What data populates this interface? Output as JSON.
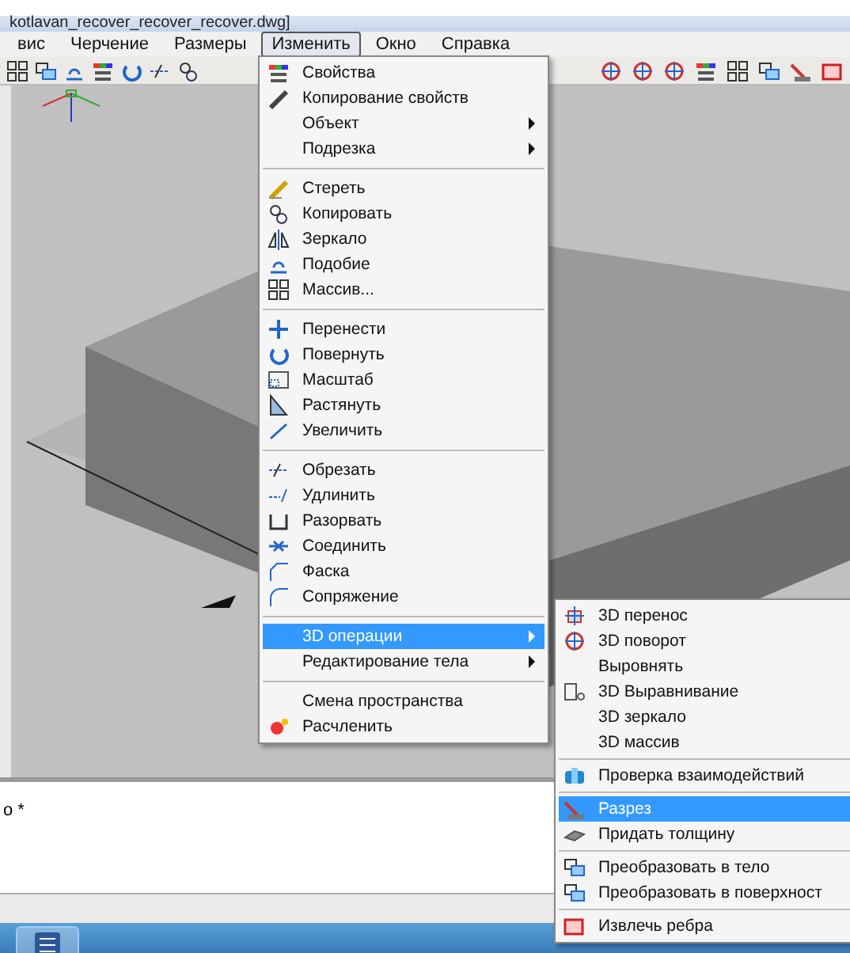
{
  "window": {
    "title": "kotlavan_recover_recover_recover.dwg]"
  },
  "menubar": [
    {
      "label": "вис",
      "selected": false
    },
    {
      "label": "Черчение",
      "selected": false
    },
    {
      "label": "Размеры",
      "selected": false
    },
    {
      "label": "Изменить",
      "selected": true
    },
    {
      "label": "Окно",
      "selected": false
    },
    {
      "label": "Справка",
      "selected": false
    }
  ],
  "menu": [
    {
      "kind": "item",
      "label": "Свойства",
      "has_submenu": false,
      "selected": false
    },
    {
      "kind": "item",
      "label": "Копирование свойств",
      "has_submenu": false,
      "selected": false
    },
    {
      "kind": "item",
      "label": "Объект",
      "has_submenu": true,
      "selected": false
    },
    {
      "kind": "item",
      "label": "Подрезка",
      "has_submenu": true,
      "selected": false
    },
    {
      "kind": "separator"
    },
    {
      "kind": "item",
      "label": "Стереть",
      "has_submenu": false,
      "selected": false
    },
    {
      "kind": "item",
      "label": "Копировать",
      "has_submenu": false,
      "selected": false
    },
    {
      "kind": "item",
      "label": "Зеркало",
      "has_submenu": false,
      "selected": false
    },
    {
      "kind": "item",
      "label": "Подобие",
      "has_submenu": false,
      "selected": false
    },
    {
      "kind": "item",
      "label": "Массив...",
      "has_submenu": false,
      "selected": false
    },
    {
      "kind": "separator"
    },
    {
      "kind": "item",
      "label": "Перенести",
      "has_submenu": false,
      "selected": false
    },
    {
      "kind": "item",
      "label": "Повернуть",
      "has_submenu": false,
      "selected": false
    },
    {
      "kind": "item",
      "label": "Масштаб",
      "has_submenu": false,
      "selected": false
    },
    {
      "kind": "item",
      "label": "Растянуть",
      "has_submenu": false,
      "selected": false
    },
    {
      "kind": "item",
      "label": "Увеличить",
      "has_submenu": false,
      "selected": false
    },
    {
      "kind": "separator"
    },
    {
      "kind": "item",
      "label": "Обрезать",
      "has_submenu": false,
      "selected": false
    },
    {
      "kind": "item",
      "label": "Удлинить",
      "has_submenu": false,
      "selected": false
    },
    {
      "kind": "item",
      "label": "Разорвать",
      "has_submenu": false,
      "selected": false
    },
    {
      "kind": "item",
      "label": "Соединить",
      "has_submenu": false,
      "selected": false
    },
    {
      "kind": "item",
      "label": "Фаска",
      "has_submenu": false,
      "selected": false
    },
    {
      "kind": "item",
      "label": "Сопряжение",
      "has_submenu": false,
      "selected": false
    },
    {
      "kind": "separator"
    },
    {
      "kind": "item",
      "label": "3D операции",
      "has_submenu": true,
      "selected": true
    },
    {
      "kind": "item",
      "label": "Редактирование тела",
      "has_submenu": true,
      "selected": false
    },
    {
      "kind": "separator"
    },
    {
      "kind": "item",
      "label": "Смена пространства",
      "has_submenu": false,
      "selected": false
    },
    {
      "kind": "item",
      "label": "Расчленить",
      "has_submenu": false,
      "selected": false
    }
  ],
  "submenu": [
    {
      "kind": "item",
      "label": "3D перенос",
      "selected": false
    },
    {
      "kind": "item",
      "label": "3D поворот",
      "selected": false
    },
    {
      "kind": "item",
      "label": "Выровнять",
      "selected": false
    },
    {
      "kind": "item",
      "label": "3D Выравнивание",
      "selected": false
    },
    {
      "kind": "item",
      "label": "3D зеркало",
      "selected": false
    },
    {
      "kind": "item",
      "label": "3D массив",
      "selected": false
    },
    {
      "kind": "separator"
    },
    {
      "kind": "item",
      "label": "Проверка взаимодействий",
      "selected": false
    },
    {
      "kind": "separator"
    },
    {
      "kind": "item",
      "label": "Разрез",
      "selected": true
    },
    {
      "kind": "item",
      "label": "Придать толщину",
      "selected": false
    },
    {
      "kind": "separator"
    },
    {
      "kind": "item",
      "label": "Преобразовать в тело",
      "selected": false
    },
    {
      "kind": "item",
      "label": "Преобразовать в поверхност",
      "selected": false
    },
    {
      "kind": "separator"
    },
    {
      "kind": "item",
      "label": "Извлечь ребра",
      "selected": false
    }
  ],
  "command_line": {
    "text": "о *"
  }
}
